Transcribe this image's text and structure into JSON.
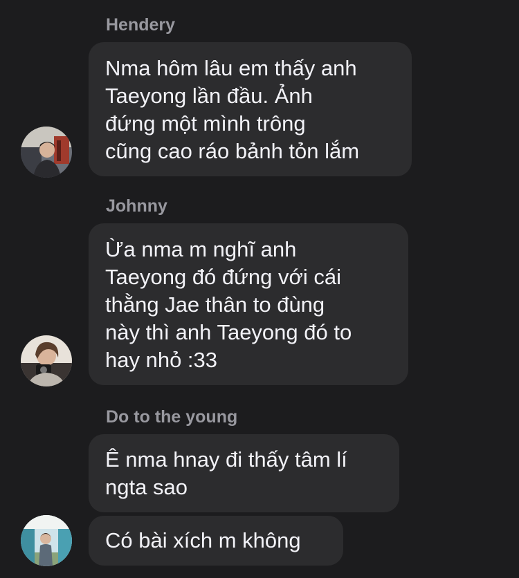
{
  "messages": [
    {
      "sender": "Hendery",
      "lines": [
        "Nma hôm lâu em thấy anh",
        "Taeyong lần đầu. Ảnh",
        "đứng một mình trông",
        "cũng cao ráo bảnh tỏn lắm"
      ],
      "avatar_icon": "avatar-hendery"
    },
    {
      "sender": "Johnny",
      "lines": [
        "Ừa nma m nghĩ anh",
        "Taeyong đó đứng với cái",
        "thằng Jae thân to đùng",
        "này thì anh Taeyong đó to",
        "hay nhỏ :33"
      ],
      "avatar_icon": "avatar-johnny"
    },
    {
      "sender": "Do to the young",
      "lines": [
        "Ê nma hnay đi thấy tâm lí",
        "ngta sao"
      ],
      "lines2": [
        "Có bài xích m không"
      ],
      "avatar_icon": "avatar-doyoung"
    }
  ],
  "colors": {
    "background": "#1c1c1e",
    "bubble": "#2c2c2e",
    "sender_name": "#98989f",
    "text": "#f2f2f7"
  }
}
